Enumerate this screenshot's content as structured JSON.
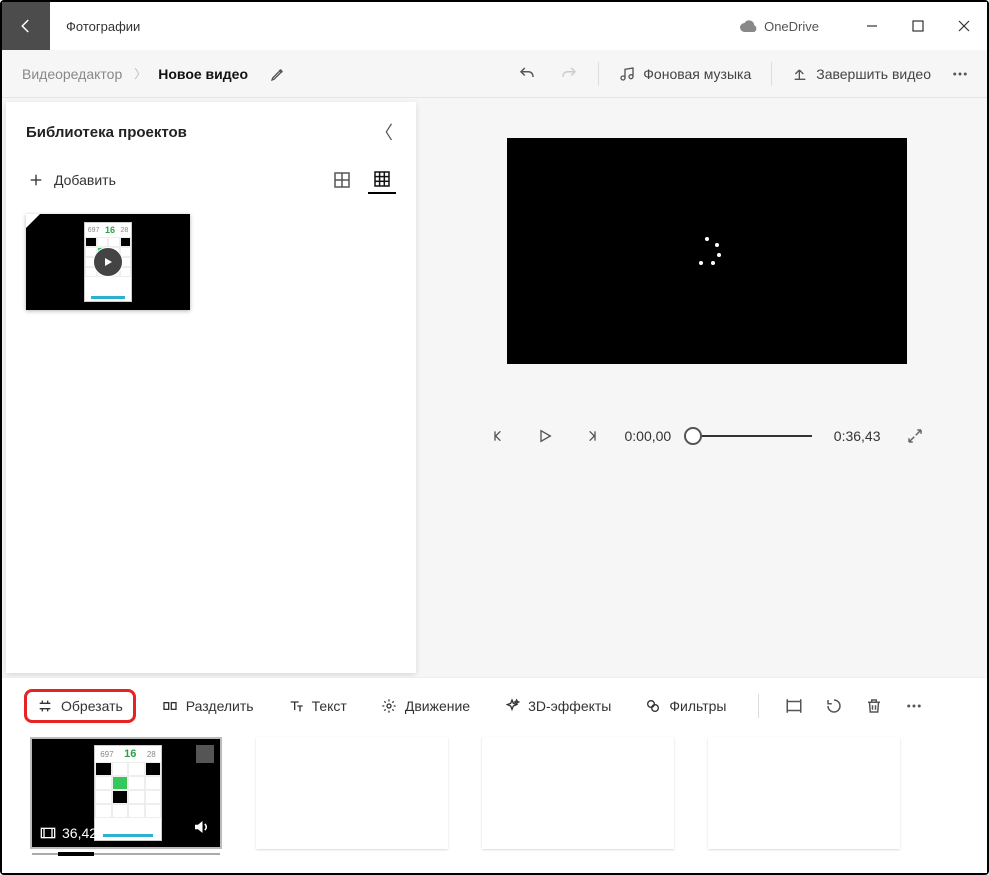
{
  "title": "Фотографии",
  "onedrive_label": "OneDrive",
  "breadcrumb": {
    "root": "Видеоредактор",
    "current": "Новое видео"
  },
  "toolbar": {
    "bg_music": "Фоновая музыка",
    "finish": "Завершить видео"
  },
  "library": {
    "title": "Библиотека проектов",
    "add_label": "Добавить",
    "clip_num": "16"
  },
  "player": {
    "current_time": "0:00,00",
    "total_time": "0:36,43"
  },
  "storybar": {
    "trim": "Обрезать",
    "split": "Разделить",
    "text": "Текст",
    "motion": "Движение",
    "effects3d": "3D-эффекты",
    "filters": "Фильтры"
  },
  "storyboard": {
    "clip_num": "16",
    "duration": "36,42"
  }
}
